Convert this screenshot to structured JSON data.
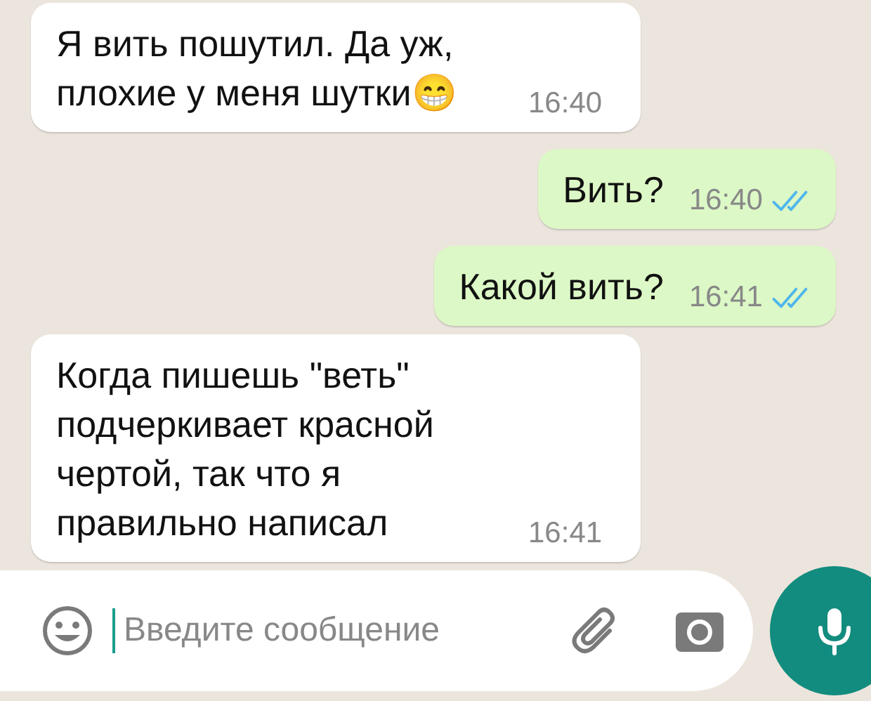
{
  "messages": [
    {
      "kind": "incoming",
      "text": "Я вить пошутил. Да уж, плохие у меня шутки😁",
      "time": "16:40"
    },
    {
      "kind": "outgoing",
      "text": "Вить?",
      "time": "16:40",
      "read": true
    },
    {
      "kind": "outgoing",
      "text": "Какой вить?",
      "time": "16:41",
      "read": true
    },
    {
      "kind": "incoming",
      "text": "Когда пишешь \"веть\" подчеркивает красной чертой, так что я правильно написал",
      "time": "16:41"
    }
  ],
  "composer": {
    "placeholder": "Введите сообщение"
  }
}
